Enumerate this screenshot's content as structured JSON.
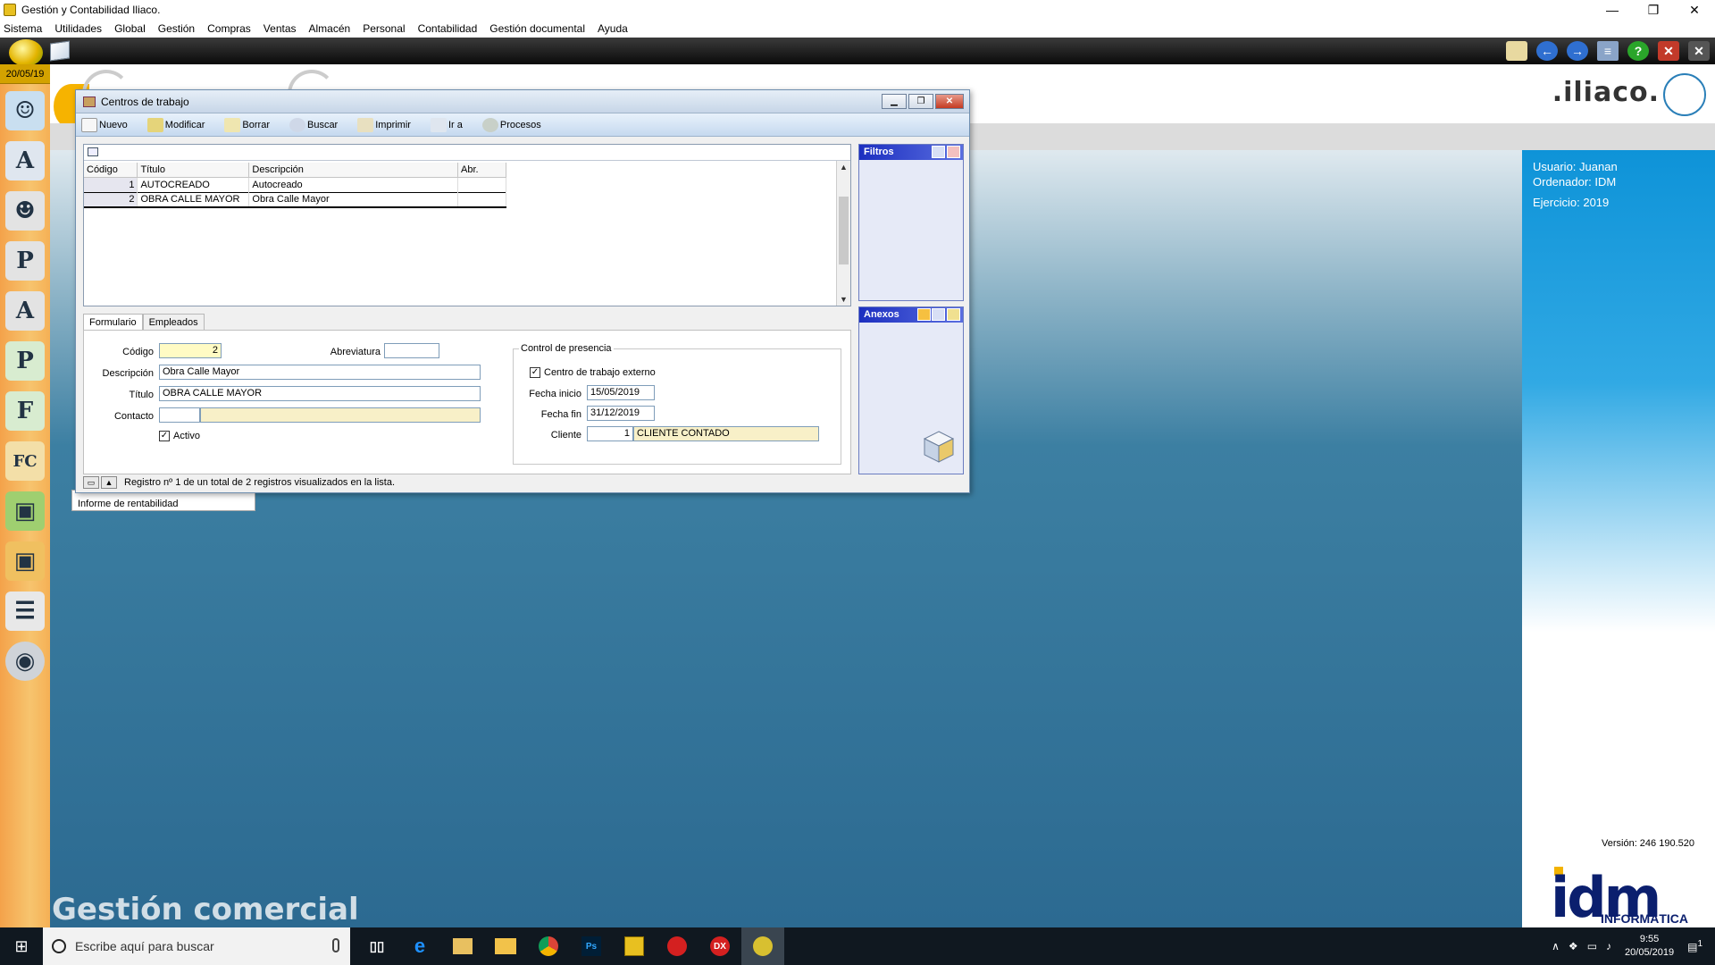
{
  "window": {
    "title": "Gestión y Contabilidad Iliaco.",
    "controls": {
      "minimize": "—",
      "maximize": "❐",
      "close": "✕"
    }
  },
  "menu": [
    "Sistema",
    "Utilidades",
    "Global",
    "Gestión",
    "Compras",
    "Ventas",
    "Almacén",
    "Personal",
    "Contabilidad",
    "Gestión documental",
    "Ayuda"
  ],
  "sidebar": {
    "date": "20/05/19"
  },
  "header": {
    "logo": ".iliaco."
  },
  "info": {
    "usuario": "Usuario: Juanan",
    "ordenador": "Ordenador: IDM",
    "ejercicio": "Ejercicio: 2019",
    "version": "Versión: 246 190.520",
    "brand": "idm",
    "brand_sub": "INFORMÁTICA"
  },
  "desktop": {
    "module_title": "Gestión comercial",
    "behind_list_item": "Informe de rentabilidad"
  },
  "dialog": {
    "title": "Centros de trabajo",
    "toolbar": {
      "nuevo": "Nuevo",
      "modificar": "Modificar",
      "borrar": "Borrar",
      "buscar": "Buscar",
      "imprimir": "Imprimir",
      "ir_a": "Ir a",
      "procesos": "Procesos"
    },
    "grid": {
      "headers": {
        "codigo": "Código",
        "titulo": "Título",
        "descripcion": "Descripción",
        "abr": "Abr."
      },
      "rows": [
        {
          "codigo": "1",
          "titulo": "AUTOCREADO",
          "descripcion": "Autocreado",
          "abr": ""
        },
        {
          "codigo": "2",
          "titulo": "OBRA CALLE MAYOR",
          "descripcion": "Obra Calle Mayor",
          "abr": ""
        }
      ]
    },
    "panels": {
      "filtros": "Filtros",
      "anexos": "Anexos"
    },
    "tabs": {
      "formulario": "Formulario",
      "empleados": "Empleados"
    },
    "form": {
      "codigo_label": "Código",
      "codigo": "2",
      "abreviatura_label": "Abreviatura",
      "abreviatura": "",
      "descripcion_label": "Descripción",
      "descripcion": "Obra Calle Mayor",
      "titulo_label": "Título",
      "titulo": "OBRA CALLE MAYOR",
      "contacto_label": "Contacto",
      "contacto_code": "",
      "contacto_name": "",
      "activo_label": "Activo"
    },
    "presencia": {
      "title": "Control de presencia",
      "externo_label": "Centro de trabajo externo",
      "fecha_inicio_label": "Fecha inicio",
      "fecha_inicio": "15/05/2019",
      "fecha_fin_label": "Fecha fin",
      "fecha_fin": "31/12/2019",
      "cliente_label": "Cliente",
      "cliente_code": "1",
      "cliente_name": "CLIENTE CONTADO"
    },
    "status": "Registro nº 1 de un total de 2 registros visualizados en la lista."
  },
  "taskbar": {
    "search_placeholder": "Escribe aquí para buscar",
    "time": "9:55",
    "date": "20/05/2019",
    "notifications": "1"
  }
}
